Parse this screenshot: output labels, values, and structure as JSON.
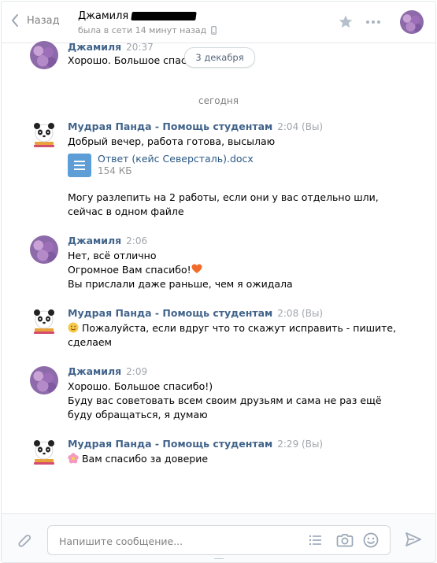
{
  "header": {
    "back_label": "Назад",
    "peer_name": "Джамиля",
    "peer_status": "была в сети 14 минут назад"
  },
  "conversation": {
    "top_message": {
      "name": "Джамиля",
      "time": "20:37",
      "text": "Хорошо. Большое спасибо!"
    },
    "date_pill": "3 декабря",
    "today_separator": "сегодня",
    "messages": [
      {
        "name": "Мудрая Панда - Помощь студентам",
        "time": "2:04",
        "you": "(Вы)",
        "lines": [
          "Добрый вечер, работа готова, высылаю"
        ],
        "attachment": {
          "name": "Ответ (кейс Северсталь).docx",
          "size": "154 КБ"
        },
        "after_lines": [
          "Могу разлепить на 2 работы, если они у вас отдельно шли,",
          "сейчас в одном файле"
        ]
      },
      {
        "name": "Джамиля",
        "time": "2:06",
        "lines": [
          "Нет, всё отлично",
          "Огромное Вам спасибо!",
          "Вы прислали даже раньше, чем я ожидала"
        ]
      },
      {
        "name": "Мудрая Панда - Помощь студентам",
        "time": "2:08",
        "you": "(Вы)",
        "lines": [
          " Пожалуйста, если вдруг что то скажут исправить - пишите,",
          "сделаем"
        ]
      },
      {
        "name": "Джамиля",
        "time": "2:09",
        "lines": [
          "Хорошо. Большое спасибо!)",
          "Буду вас советовать всем своим друзьям и сама не раз ещё",
          "буду обращаться, я думаю"
        ]
      },
      {
        "name": "Мудрая Панда - Помощь студентам",
        "time": "2:29",
        "you": "(Вы)",
        "lines": [
          " Вам спасибо за доверие"
        ]
      }
    ]
  },
  "composer": {
    "placeholder": "Напишите сообщение..."
  },
  "colors": {
    "accent": "#42648b",
    "link": "#2a5885",
    "muted": "#828282"
  }
}
